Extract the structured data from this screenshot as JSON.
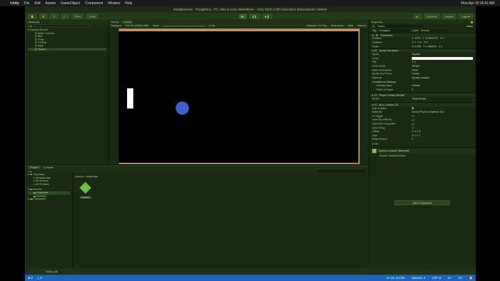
{
  "menubar": {
    "apple": "",
    "app": "Unity",
    "items": [
      "File",
      "Edit",
      "Assets",
      "GameObject",
      "Component",
      "Window",
      "Help"
    ],
    "clock": "Mon Apr 19 10:41 AM"
  },
  "window": {
    "title": "SampleScene - PongDemo - PC, Mac & Linux Standalone - Unity 2020.3.25f1 Education (Educational) <Metal>"
  },
  "toolbar": {
    "pivot": "Pivot",
    "local": "Local",
    "account": "Account",
    "layers": "Layers",
    "layout": "Layout"
  },
  "hierarchy": {
    "tab": "Hierarchy",
    "items": [
      "SampleScene*",
      "Main Camera",
      "Ball",
      "Floor",
      "Ceiling",
      "Wall",
      "Player"
    ]
  },
  "scene": {
    "tab_scene": "Scene",
    "tab_game": "Game",
    "display": "Display 1",
    "resolution": "Full HD (1920x1080)",
    "scale_label": "Scale",
    "scale_value": "0.44x",
    "maximize": "Maximize On Play",
    "mute": "Mute Audio",
    "stats": "Stats",
    "gizmos": "Gizmos"
  },
  "inspector": {
    "tab": "Inspector",
    "object": "Player",
    "static": "Static",
    "tag_label": "Tag",
    "tag": "Untagged",
    "layer_label": "Layer",
    "layer": "Default",
    "transform": "Transform",
    "position": {
      "label": "Position",
      "x": "X -8.04",
      "y": "Y -0.2062371",
      "z": "Z 0"
    },
    "rotation": {
      "label": "Rotation",
      "x": "X 0",
      "y": "Y 0",
      "z": "Z 0"
    },
    "scale": {
      "label": "Scale",
      "x": "X 0.435",
      "y": "Y 1.496326",
      "z": "Z 1"
    },
    "sprite_renderer": "Sprite Renderer",
    "sr_rows": [
      [
        "Sprite",
        "Square"
      ],
      [
        "Color",
        ""
      ],
      [
        "Flip",
        "X  Y"
      ],
      [
        "Draw Mode",
        "Simple"
      ],
      [
        "Mask Interaction",
        "None"
      ],
      [
        "Sprite Sort Point",
        "Center"
      ],
      [
        "Material",
        "Sprites-Default"
      ]
    ],
    "additional": "Additional Settings",
    "sorting_layer": [
      "Sorting Layer",
      "Default"
    ],
    "order": [
      "Order in Layer",
      "0"
    ],
    "player_script": "Player Script (Script)",
    "script_row": [
      "Script",
      "PlayerScript"
    ],
    "box_collider": "Box Collider 2D",
    "edit_collider": "Edit Collider",
    "bc_rows": [
      [
        "Material",
        "None (Physics Material 2D)"
      ],
      [
        "Is Trigger",
        ""
      ],
      [
        "Used By Effector",
        ""
      ],
      [
        "Used By Composite",
        ""
      ],
      [
        "Auto Tiling",
        ""
      ],
      [
        "Offset",
        "X 0   Y 0"
      ],
      [
        "Size",
        "X 1   Y 1"
      ],
      [
        "Edge Radius",
        "0"
      ]
    ],
    "info": "Info",
    "material_name": "Sprites-Default (Material)",
    "shader_label": "Shader",
    "shader": "Sprites/Default",
    "add_component": "Add Component"
  },
  "project": {
    "tab_project": "Project",
    "tab_console": "Console",
    "favorites": "Favorites",
    "fav_items": [
      "All Materials",
      "All Models",
      "All Prefabs"
    ],
    "assets": "Assets",
    "asset_items": [
      "Materials",
      "Scenes"
    ],
    "packages": "Packages",
    "breadcrumb": "Assets > Materials",
    "asset_name": "Paddles"
  },
  "timeline": {
    "label": "TIMELINE"
  },
  "status": {
    "errors": "⊗ 0",
    "warnings": "△ 0",
    "position": "Ln 12, Col 50",
    "spaces": "Spaces: 4",
    "encoding": "UTF-8",
    "eol": "LF",
    "lang": "C#"
  }
}
